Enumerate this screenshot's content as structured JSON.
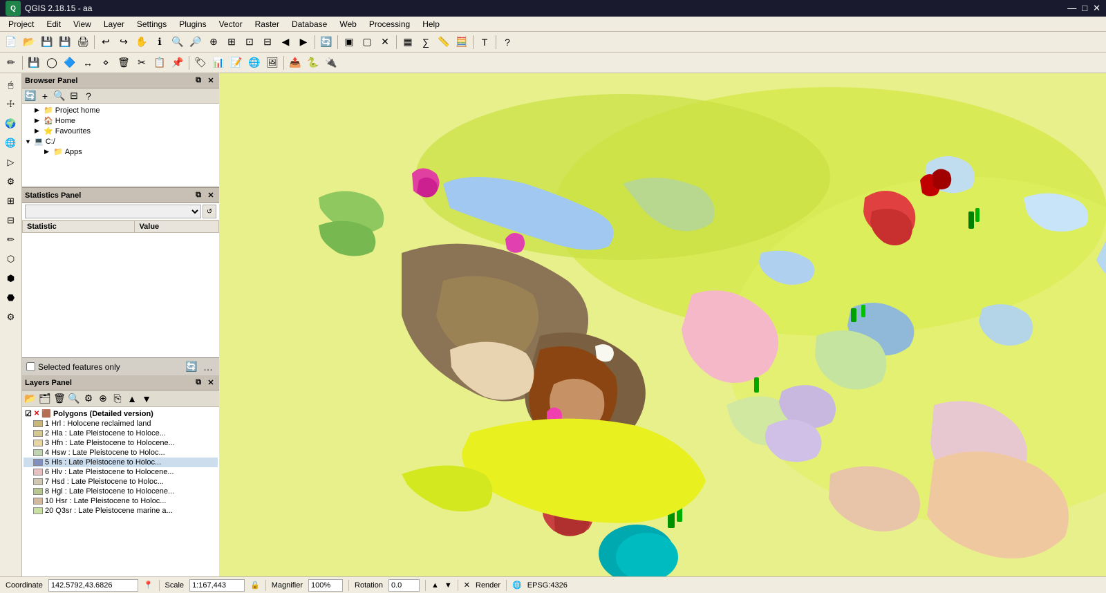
{
  "app": {
    "title": "QGIS 2.18.15 - aa",
    "icon": "QGIS"
  },
  "titlebar": {
    "minimize": "—",
    "maximize": "□",
    "close": "✕"
  },
  "menubar": {
    "items": [
      "Project",
      "Edit",
      "View",
      "Layer",
      "Settings",
      "Plugins",
      "Vector",
      "Raster",
      "Database",
      "Web",
      "Processing",
      "Help"
    ]
  },
  "browser_panel": {
    "title": "Browser Panel",
    "toolbar_icons": [
      "refresh",
      "filter",
      "collapse",
      "help"
    ],
    "tree": [
      {
        "label": "Project home",
        "indent": 1,
        "icon": "📁",
        "expand": "▶"
      },
      {
        "label": "Home",
        "indent": 1,
        "icon": "🏠",
        "expand": "▶"
      },
      {
        "label": "Favourites",
        "indent": 1,
        "icon": "⭐",
        "expand": "▶"
      },
      {
        "label": "C:/",
        "indent": 0,
        "icon": "💻",
        "expand": "▼"
      },
      {
        "label": "Apps",
        "indent": 2,
        "icon": "📁",
        "expand": "▶"
      }
    ]
  },
  "stats_panel": {
    "title": "Statistics Panel",
    "field_placeholder": "",
    "columns": [
      {
        "label": "Statistic"
      },
      {
        "label": "Value"
      }
    ]
  },
  "selected_features": {
    "label": "Selected features only",
    "checked": false
  },
  "layers_panel": {
    "title": "Layers Panel",
    "layers": [
      {
        "id": 1,
        "name": "Polygons (Detailed version)",
        "visible": true,
        "active": true,
        "color": "#8B7355"
      },
      {
        "id": 2,
        "sublabel": "1 Hrl : Holocene reclaimed land",
        "color": "#c8b878"
      },
      {
        "id": 3,
        "sublabel": "2 Hla : Late Pleistocene to Holocene...",
        "color": "#d4c890"
      },
      {
        "id": 4,
        "sublabel": "3 Hfn : Late Pleistocene to Holocene...",
        "color": "#e8d4a0"
      },
      {
        "id": 5,
        "sublabel": "4 Hsw : Late Pleistocene to Holoce...",
        "color": "#c0d4b0"
      },
      {
        "id": 6,
        "sublabel": "5 Hls : Late Pleistocene to Holoce...",
        "color": "#8090c0",
        "selected": true
      },
      {
        "id": 7,
        "sublabel": "6 Hlv : Late Pleistocene to Holocene...",
        "color": "#e8c0c0"
      },
      {
        "id": 8,
        "sublabel": "7 Hsd : Late Pleistocene to Holoce...",
        "color": "#d0c8b0"
      },
      {
        "id": 9,
        "sublabel": "8 Hgl : Late Pleistocene to Holocene...",
        "color": "#b8c890"
      },
      {
        "id": 10,
        "sublabel": "10 Hsr : Late Pleistocene to Holoce...",
        "color": "#d4b8a0"
      },
      {
        "id": 11,
        "sublabel": "20 Q3sr : Late Pleistocene marine a...",
        "color": "#c8e0a0"
      }
    ]
  },
  "statusbar": {
    "coordinate_label": "Coordinate",
    "coordinate_value": "142.5792,43.6826",
    "scale_label": "Scale",
    "scale_value": "1:167,443",
    "magnifier_label": "Magnifier",
    "magnifier_value": "100%",
    "rotation_label": "Rotation",
    "rotation_value": "0.0",
    "render_label": "Render",
    "epsg_label": "EPSG:4326"
  }
}
